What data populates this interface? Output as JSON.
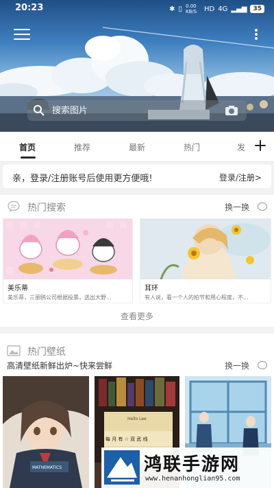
{
  "status_bar": {
    "time": "20:23",
    "speed": "0.00 KB/S",
    "network": "4G",
    "battery": "35"
  },
  "search": {
    "placeholder": "搜索图片"
  },
  "tabs": [
    {
      "label": "首页",
      "active": true
    },
    {
      "label": "推荐"
    },
    {
      "label": "最新"
    },
    {
      "label": "热门"
    },
    {
      "label": "发"
    }
  ],
  "login_banner": {
    "message": "亲，登录/注册账号后使用更方便哦!",
    "link": "登录/注册>"
  },
  "hot_search": {
    "title": "热门搜索",
    "swap_label": "换一换",
    "cards": [
      {
        "name": "美乐蒂",
        "desc": "美乐蒂，三丽鸥公司根据投票，选出大野..."
      },
      {
        "name": "耳环",
        "desc": "有人说，看一个人的拍节和用心程度，不..."
      }
    ],
    "see_more": "查看更多"
  },
  "hot_wallpaper": {
    "title": "热门壁纸",
    "subtitle": "高清壁纸新鲜出炉~快来尝鲜",
    "swap_label": "换一换",
    "book_text": "MATHEMATICS",
    "book_title": "Hello Lee",
    "book_spine": "每 月 有 ☆ 双 武 线"
  },
  "watermark": {
    "brand": "鸿联手游网",
    "url": "www.henanhonglian95.com"
  },
  "colors": {
    "accent": "#2b2b2b",
    "hero_sky": "#3f7fbf"
  }
}
